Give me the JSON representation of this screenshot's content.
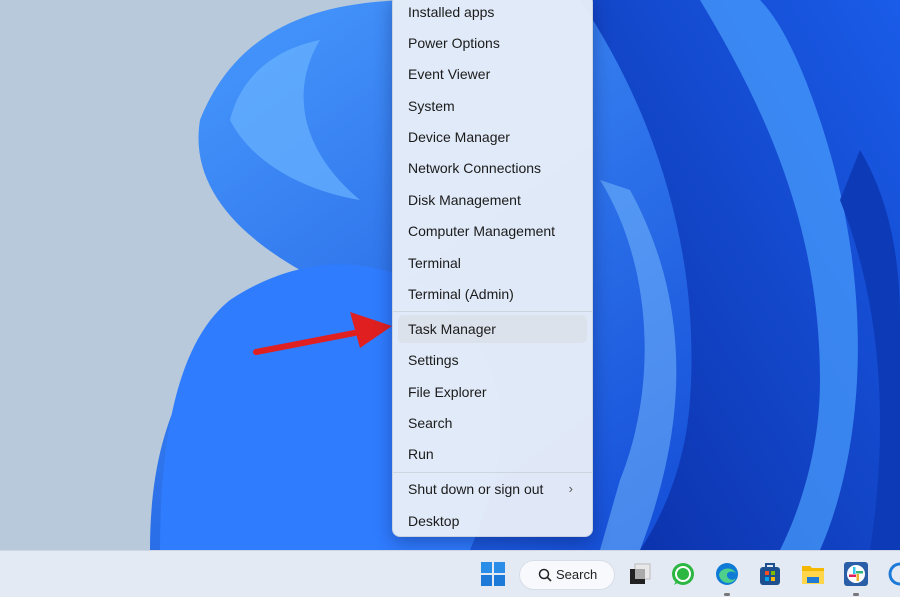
{
  "menu": {
    "items": [
      {
        "label": "Installed apps"
      },
      {
        "label": "Power Options"
      },
      {
        "label": "Event Viewer"
      },
      {
        "label": "System"
      },
      {
        "label": "Device Manager"
      },
      {
        "label": "Network Connections"
      },
      {
        "label": "Disk Management"
      },
      {
        "label": "Computer Management"
      },
      {
        "label": "Terminal"
      },
      {
        "label": "Terminal (Admin)"
      },
      {
        "label": "Task Manager",
        "highlighted": true
      },
      {
        "label": "Settings"
      },
      {
        "label": "File Explorer"
      },
      {
        "label": "Search"
      },
      {
        "label": "Run"
      },
      {
        "label": "Shut down or sign out",
        "submenu": true
      },
      {
        "label": "Desktop"
      }
    ]
  },
  "taskbar": {
    "search_label": "Search",
    "apps": [
      "start-icon",
      "task-view-icon",
      "whatsapp-icon",
      "edge-icon",
      "microsoft-store-icon",
      "file-explorer-icon",
      "slack-icon",
      "cortana-icon"
    ]
  },
  "colors": {
    "accent": "#0067c0",
    "arrow": "#e02020",
    "wallpaper": "#1e6cf0"
  }
}
